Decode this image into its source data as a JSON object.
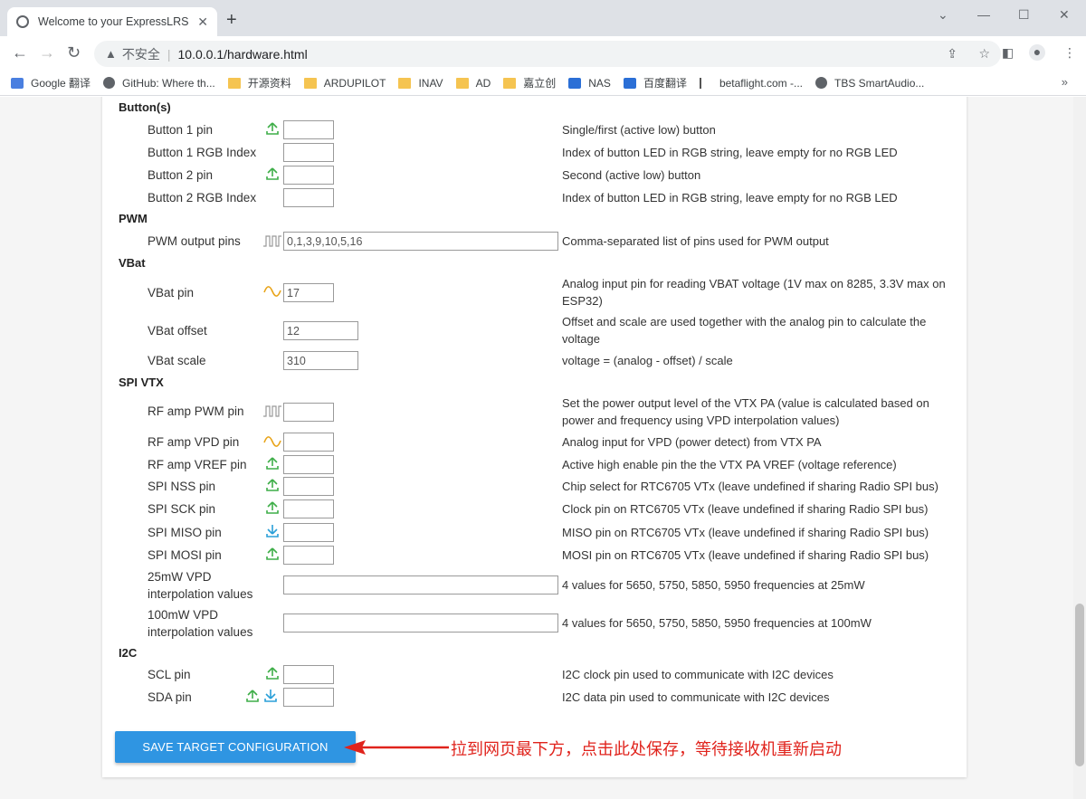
{
  "browser": {
    "tab_title": "Welcome to your ExpressLRS S",
    "insecure_label": "不安全",
    "url": "10.0.0.1/hardware.html",
    "bookmarks": [
      {
        "label": "Google 翻译",
        "icon": "translate-icon"
      },
      {
        "label": "GitHub: Where th...",
        "icon": "github-icon"
      },
      {
        "label": "开源资料",
        "icon": "folder-icon"
      },
      {
        "label": "ARDUPILOT",
        "icon": "folder-icon"
      },
      {
        "label": "INAV",
        "icon": "folder-icon"
      },
      {
        "label": "AD",
        "icon": "folder-icon"
      },
      {
        "label": "嘉立创",
        "icon": "folder-icon"
      },
      {
        "label": "NAS",
        "icon": "dsm-icon"
      },
      {
        "label": "百度翻译",
        "icon": "baidu-translate-icon"
      },
      {
        "label": "betaflight.com -...",
        "icon": "betaflight-icon"
      },
      {
        "label": "TBS SmartAudio...",
        "icon": "globe-icon"
      }
    ]
  },
  "sections": {
    "buttons": "Button(s)",
    "pwm": "PWM",
    "vbat": "VBat",
    "spivtx": "SPI VTX",
    "i2c": "I2C"
  },
  "fields": {
    "button1_pin": {
      "label": "Button 1 pin",
      "value": "",
      "desc": "Single/first (active low) button",
      "icon": "output-pin-icon"
    },
    "button1_rgb": {
      "label": "Button 1 RGB Index",
      "value": "",
      "desc": "Index of button LED in RGB string, leave empty for no RGB LED"
    },
    "button2_pin": {
      "label": "Button 2 pin",
      "value": "",
      "desc": "Second (active low) button",
      "icon": "output-pin-icon"
    },
    "button2_rgb": {
      "label": "Button 2 RGB Index",
      "value": "",
      "desc": "Index of button LED in RGB string, leave empty for no RGB LED"
    },
    "pwm_pins": {
      "label": "PWM output pins",
      "value": "0,1,3,9,10,5,16",
      "desc": "Comma-separated list of pins used for PWM output",
      "icon": "pwm-icon"
    },
    "vbat_pin": {
      "label": "VBat pin",
      "value": "17",
      "desc": "Analog input pin for reading VBAT voltage (1V max on 8285, 3.3V max on ESP32)",
      "icon": "analog-icon"
    },
    "vbat_offset": {
      "label": "VBat offset",
      "value": "12",
      "desc": "Offset and scale are used together with the analog pin to calculate the voltage"
    },
    "vbat_scale": {
      "label": "VBat scale",
      "value": "310",
      "desc": "voltage = (analog - offset) / scale"
    },
    "rf_pwm": {
      "label": "RF amp PWM pin",
      "value": "",
      "desc": "Set the power output level of the VTX PA (value is calculated based on power and frequency using VPD interpolation values)",
      "icon": "pwm-icon"
    },
    "rf_vpd": {
      "label": "RF amp VPD pin",
      "value": "",
      "desc": "Analog input for VPD (power detect) from VTX PA",
      "icon": "analog-icon"
    },
    "rf_vref": {
      "label": "RF amp VREF pin",
      "value": "",
      "desc": "Active high enable pin the the VTX PA VREF (voltage reference)",
      "icon": "output-pin-icon"
    },
    "spi_nss": {
      "label": "SPI NSS pin",
      "value": "",
      "desc": "Chip select for RTC6705 VTx (leave undefined if sharing Radio SPI bus)",
      "icon": "output-pin-icon"
    },
    "spi_sck": {
      "label": "SPI SCK pin",
      "value": "",
      "desc": "Clock pin on RTC6705 VTx (leave undefined if sharing Radio SPI bus)",
      "icon": "output-pin-icon"
    },
    "spi_miso": {
      "label": "SPI MISO pin",
      "value": "",
      "desc": "MISO pin on RTC6705 VTx (leave undefined if sharing Radio SPI bus)",
      "icon": "input-pin-icon"
    },
    "spi_mosi": {
      "label": "SPI MOSI pin",
      "value": "",
      "desc": "MOSI pin on RTC6705 VTx (leave undefined if sharing Radio SPI bus)",
      "icon": "output-pin-icon"
    },
    "vpd25": {
      "label_1": "25mW VPD",
      "label_2": "interpolation values",
      "value": "",
      "desc": "4 values for 5650, 5750, 5850, 5950 frequencies at 25mW"
    },
    "vpd100": {
      "label_1": "100mW VPD",
      "label_2": "interpolation values",
      "value": "",
      "desc": "4 values for 5650, 5750, 5850, 5950 frequencies at 100mW"
    },
    "scl": {
      "label": "SCL pin",
      "value": "",
      "desc": "I2C clock pin used to communicate with I2C devices",
      "icon": "output-pin-icon"
    },
    "sda": {
      "label": "SDA pin",
      "value": "",
      "desc": "I2C data pin used to communicate with I2C devices",
      "icon": "bidirectional-pin-icon"
    }
  },
  "save_button": "SAVE TARGET CONFIGURATION",
  "annotation": "拉到网页最下方，点击此处保存，等待接收机重新启动",
  "colors": {
    "accent": "#2f95e2",
    "annotation": "#e0231c",
    "output_icon": "#3fae49",
    "input_icon": "#2a9fd8",
    "analog_icon": "#e8a317"
  }
}
